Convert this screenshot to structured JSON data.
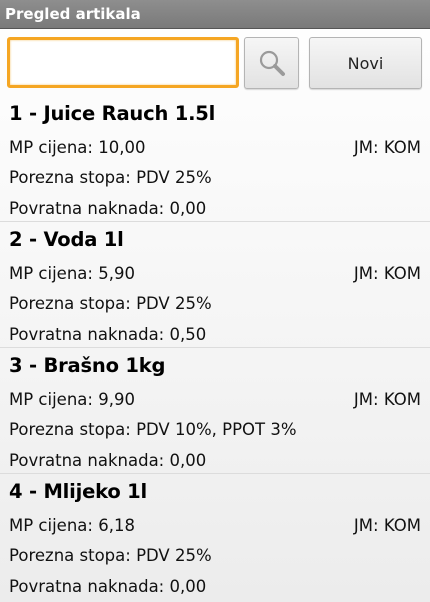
{
  "window": {
    "title": "Pregled artikala"
  },
  "search": {
    "placeholder": "",
    "value": ""
  },
  "toolbar": {
    "search_icon": "search-icon",
    "new_label": "Novi"
  },
  "labels": {
    "price": "MP cijena:",
    "tax": "Porezna stopa:",
    "deposit": "Povratna naknada:",
    "unit": "JM:"
  },
  "items": [
    {
      "title": "1 - Juice Rauch 1.5l",
      "price": "10,00",
      "unit": "KOM",
      "tax": "PDV 25%",
      "deposit": "0,00"
    },
    {
      "title": "2 - Voda 1l",
      "price": "5,90",
      "unit": "KOM",
      "tax": "PDV 25%",
      "deposit": "0,50"
    },
    {
      "title": "3 - Brašno 1kg",
      "price": "9,90",
      "unit": "KOM",
      "tax": "PDV 10%, PPOT 3%",
      "deposit": "0,00"
    },
    {
      "title": "4 - Mlijeko 1l",
      "price": "6,18",
      "unit": "KOM",
      "tax": "PDV 25%",
      "deposit": "0,00"
    }
  ]
}
